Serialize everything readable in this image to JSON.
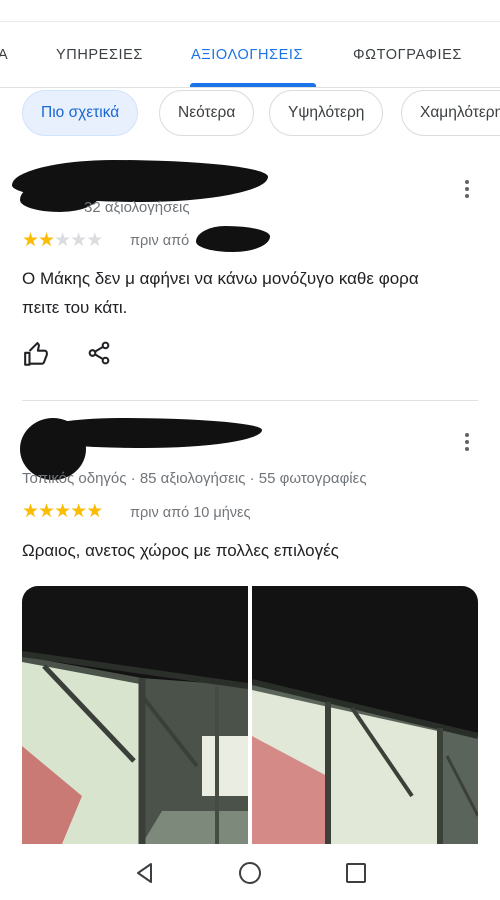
{
  "tabs": [
    {
      "label": "Α"
    },
    {
      "label": "ΥΠΗΡΕΣΙΕΣ"
    },
    {
      "label": "ΑΞΙΟΛΟΓΗΣΕΙΣ"
    },
    {
      "label": "ΦΩΤΟΓΡΑΦΙΕΣ"
    }
  ],
  "sort_chips": [
    {
      "label": "Πιο σχετικά",
      "selected": true
    },
    {
      "label": "Νεότερα",
      "selected": false
    },
    {
      "label": "Υψηλότερη",
      "selected": false
    },
    {
      "label": "Χαμηλότερη",
      "selected": false
    }
  ],
  "reviews": [
    {
      "reviewer_meta": "32 αξιολογήσεις",
      "rating": 2,
      "rating_max": 5,
      "date_text": "πριν από",
      "text": "Ο Μάκης δεν μ αφήνει να κάνω μονόζυγο καθε φορα πειτε του κάτι."
    },
    {
      "reviewer_meta": "Τοπικός οδηγός · 85 αξιολογήσεις · 55 φωτογραφίες",
      "rating": 5,
      "rating_max": 5,
      "date_text": "πριν από 10 μήνες",
      "text": "Ωραιος, ανετος χώρος  με πολλες επιλογές"
    }
  ],
  "colors": {
    "accent": "#1a73e8",
    "star": "#fbbc04",
    "star_empty": "#dadce0",
    "chip_selected_bg": "#e8f0fe"
  },
  "icons": {
    "like": "thumbs-up-icon",
    "share": "share-icon",
    "more": "more-vert-icon",
    "nav_back": "back-triangle-icon",
    "nav_home": "home-circle-icon",
    "nav_recents": "recents-square-icon"
  }
}
